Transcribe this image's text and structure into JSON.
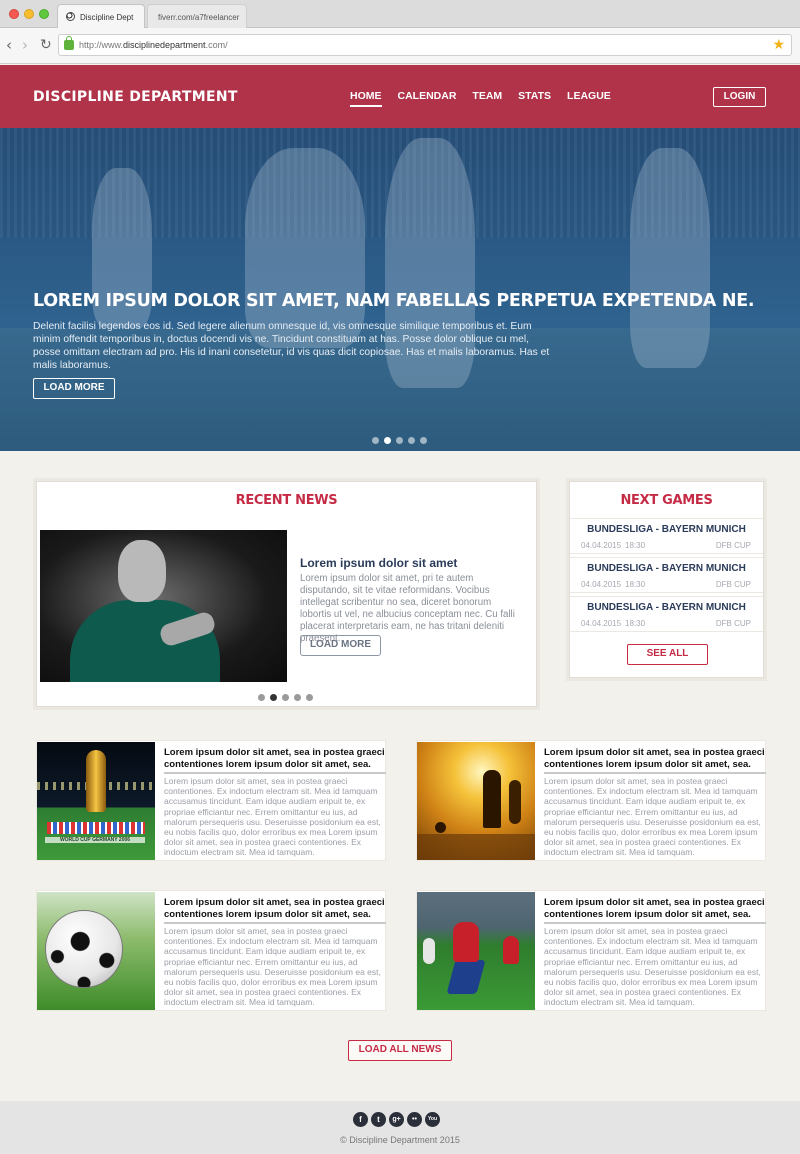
{
  "browser": {
    "tabs": [
      {
        "label": "Discipline Dept",
        "active": true
      },
      {
        "label": "fiverr.com/a7freelancer",
        "active": false
      }
    ],
    "url_prefix": "http://www.",
    "url_domain": "disciplinedepartment",
    "url_suffix": ".com/"
  },
  "header": {
    "logo": "DISCIPLINE DEPARTMENT",
    "nav": [
      "HOME",
      "CALENDAR",
      "TEAM",
      "STATS",
      "LEAGUE"
    ],
    "active_nav": "HOME",
    "login_label": "LOGIN"
  },
  "hero": {
    "title": "LOREM IPSUM DOLOR SIT AMET, NAM FABELLAS PERPETUA EXPETENDA NE.",
    "text": "Delenit facilisi legendos eos id. Sed legere alienum omnesque id, vis omnesque similique temporibus et. Eum minim offendit temporibus in, doctus docendi vis ne. Tincidunt constituam at has. Posse dolor oblique cu mel, posse omittam electram ad pro. His id inani consetetur, id vis quas dicit copiosae. Has et malis laboramus. Has et malis laboramus.",
    "button_label": "LOAD MORE",
    "slide_count": 5,
    "active_slide": 2
  },
  "recent_news": {
    "title": "RECENT NEWS",
    "headline": "Lorem ipsum dolor sit amet",
    "body": "Lorem ipsum dolor sit amet, pri te autem disputando, sit te vitae reformidans. Vocibus intellegat scribentur no sea, diceret bonorum lobortis ut vel, ne albucius conceptam nec. Cu falli placerat interpretaris eam, ne has tritani deleniti praesent.",
    "button_label": "LOAD MORE",
    "slide_count": 5,
    "active_slide": 2
  },
  "next_games": {
    "title": "NEXT GAMES",
    "games": [
      {
        "match": "BUNDESLIGA - BAYERN MUNICH",
        "date": "04.04.2015",
        "time": "18:30",
        "competition": "DFB CUP"
      },
      {
        "match": "BUNDESLIGA - BAYERN MUNICH",
        "date": "04.04.2015",
        "time": "18:30",
        "competition": "DFB CUP"
      },
      {
        "match": "BUNDESLIGA - BAYERN MUNICH",
        "date": "04.04.2015",
        "time": "18:30",
        "competition": "DFB CUP"
      }
    ],
    "see_all_label": "SEE ALL"
  },
  "articles": [
    {
      "title": "Lorem ipsum dolor sit amet, sea in postea graeci contentiones lorem ipsum dolor sit amet, sea.",
      "body": "Lorem ipsum dolor sit amet, sea in postea graeci contentiones. Ex indoctum electram sit. Mea id tamquam accusamus tincidunt. Eam idque audiam eripuit te, ex propriae efficiantur nec. Errem omittantur eu ius, ad malorum persequeris usu. Deseruisse posidonium ea est, eu nobis facilis quo, dolor erroribus ex mea Lorem ipsum dolor sit amet, sea in postea graeci contentiones. Ex indoctum electram sit. Mea id tamquam.",
      "image": "world-cup-trophy",
      "image_caption": "WORLD CUP GERMANY 2006"
    },
    {
      "title": "Lorem ipsum dolor sit amet, sea in postea graeci contentiones lorem ipsum dolor sit amet, sea.",
      "body": "Lorem ipsum dolor sit amet, sea in postea graeci contentiones. Ex indoctum electram sit. Mea id tamquam accusamus tincidunt. Eam idque audiam eripuit te, ex propriae efficiantur nec. Errem omittantur eu ius, ad malorum persequeris usu. Deseruisse posidonium ea est, eu nobis facilis quo, dolor erroribus ex mea Lorem ipsum dolor sit amet, sea in postea graeci contentiones. Ex indoctum electram sit. Mea id tamquam.",
      "image": "sunset-football"
    },
    {
      "title": "Lorem ipsum dolor sit amet, sea in postea graeci contentiones lorem ipsum dolor sit amet, sea.",
      "body": "Lorem ipsum dolor sit amet, sea in postea graeci contentiones. Ex indoctum electram sit. Mea id tamquam accusamus tincidunt. Eam idque audiam eripuit te, ex propriae efficiantur nec. Errem omittantur eu ius, ad malorum persequeris usu. Deseruisse posidonium ea est, eu nobis facilis quo, dolor erroribus ex mea Lorem ipsum dolor sit amet, sea in postea graeci contentiones. Ex indoctum electram sit. Mea id tamquam.",
      "image": "soccer-ball"
    },
    {
      "title": "Lorem ipsum dolor sit amet, sea in postea graeci contentiones lorem ipsum dolor sit amet, sea.",
      "body": "Lorem ipsum dolor sit amet, sea in postea graeci contentiones. Ex indoctum electram sit. Mea id tamquam accusamus tincidunt. Eam idque audiam eripuit te, ex propriae efficiantur nec. Errem omittantur eu ius, ad malorum persequeris usu. Deseruisse posidonium ea est, eu nobis facilis quo, dolor erroribus ex mea Lorem ipsum dolor sit amet, sea in postea graeci contentiones. Ex indoctum electram sit. Mea id tamquam.",
      "image": "spain-players-celebrating"
    }
  ],
  "load_all_label": "LOAD ALL NEWS",
  "footer": {
    "socials": [
      {
        "icon": "facebook-icon",
        "glyph": "f"
      },
      {
        "icon": "twitter-icon",
        "glyph": "t"
      },
      {
        "icon": "google-plus-icon",
        "glyph": "g+"
      },
      {
        "icon": "flickr-icon",
        "glyph": "••"
      },
      {
        "icon": "youtube-icon",
        "glyph": "You"
      }
    ],
    "copyright": "© Discipline Department 2015"
  },
  "colors": {
    "header_bg": "#b0334a",
    "accent": "#c62b45",
    "hero_overlay": "#2b5985",
    "heading_navy": "#2b3b5a"
  }
}
